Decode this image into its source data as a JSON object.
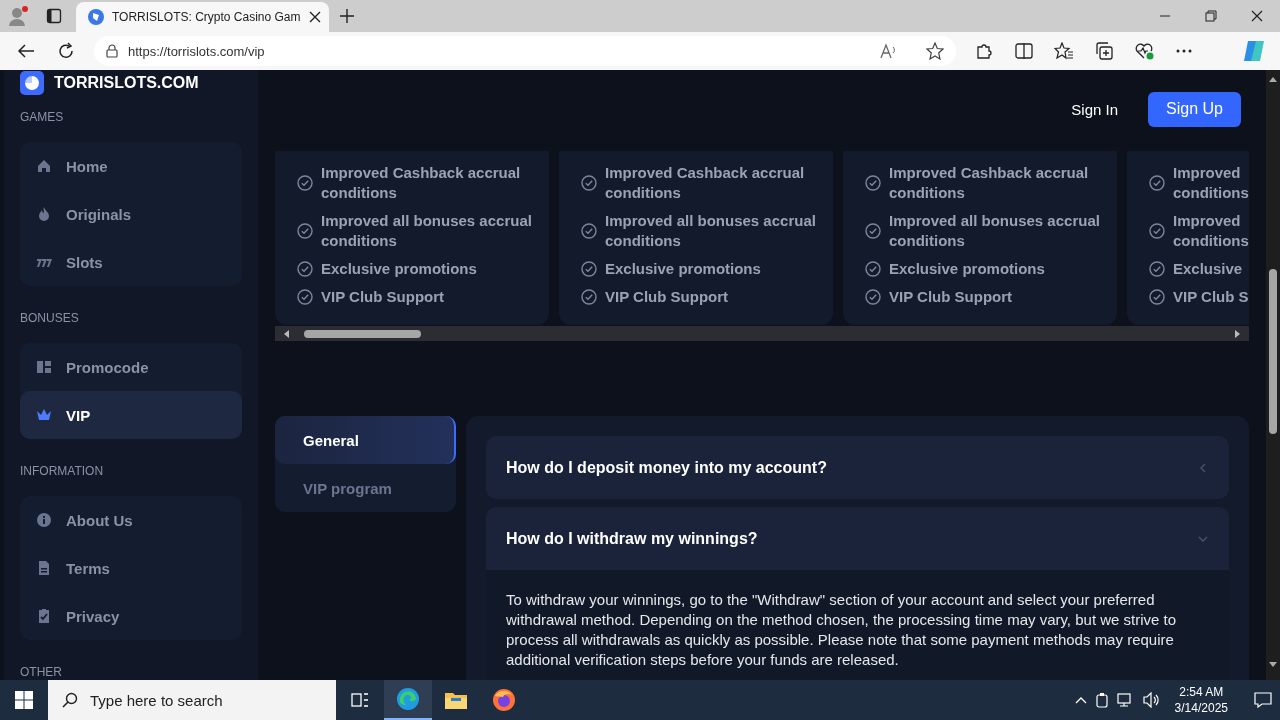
{
  "browser": {
    "tab_title": "TORRISLOTS: Crypto Casino Gam",
    "url": "https://torrislots.com/vip"
  },
  "sidebar": {
    "logo": "TORRISLOTS.COM",
    "sections": [
      {
        "label": "GAMES",
        "items": [
          {
            "label": "Home",
            "selected": false
          },
          {
            "label": "Originals",
            "selected": false
          },
          {
            "label": "Slots",
            "selected": false
          }
        ]
      },
      {
        "label": "BONUSES",
        "items": [
          {
            "label": "Promocode",
            "selected": false
          },
          {
            "label": "VIP",
            "selected": true
          }
        ]
      },
      {
        "label": "INFORMATION",
        "items": [
          {
            "label": "About Us",
            "selected": false
          },
          {
            "label": "Terms",
            "selected": false
          },
          {
            "label": "Privacy",
            "selected": false
          }
        ]
      },
      {
        "label": "OTHER"
      }
    ]
  },
  "header": {
    "sign_in": "Sign In",
    "sign_up": "Sign Up"
  },
  "vip_cards": [
    {
      "features": [
        {
          "lines": [
            "Improved Cashback accrual conditions"
          ]
        },
        {
          "lines": [
            "Improved all bonuses accrual conditions"
          ]
        },
        {
          "lines": [
            "Exclusive promotions"
          ]
        },
        {
          "lines": [
            "VIP Club Support"
          ]
        }
      ]
    },
    {
      "features": [
        {
          "lines": [
            "Improved Cashback accrual conditions"
          ]
        },
        {
          "lines": [
            "Improved all bonuses accrual conditions"
          ]
        },
        {
          "lines": [
            "Exclusive promotions"
          ]
        },
        {
          "lines": [
            "VIP Club Support"
          ]
        }
      ]
    },
    {
      "features": [
        {
          "lines": [
            "Improved Cashback accrual conditions"
          ]
        },
        {
          "lines": [
            "Improved all bonuses accrual conditions"
          ]
        },
        {
          "lines": [
            "Exclusive promotions"
          ]
        },
        {
          "lines": [
            "VIP Club Support"
          ]
        }
      ]
    },
    {
      "features": [
        {
          "lines": [
            "Improved",
            "conditions"
          ]
        },
        {
          "lines": [
            "Improved",
            "conditions"
          ]
        },
        {
          "lines": [
            "Exclusive"
          ]
        },
        {
          "lines": [
            "VIP Club S"
          ]
        }
      ]
    }
  ],
  "faq": {
    "tabs": [
      {
        "label": "General",
        "selected": true
      },
      {
        "label": "VIP program",
        "selected": false
      }
    ],
    "items": [
      {
        "question": "How do I deposit money into my account?",
        "expanded": false
      },
      {
        "question": "How do I withdraw my winnings?",
        "expanded": true,
        "answer": "To withdraw your winnings, go to the \"Withdraw\" section of your account and select your preferred withdrawal method. Depending on the method chosen, the processing time may vary, but we strive to process all withdrawals as quickly as possible. Please note that some payment methods may require additional verification steps before your funds are released."
      }
    ]
  },
  "taskbar": {
    "search_placeholder": "Type here to search",
    "time": "2:54 AM",
    "date": "3/14/2025"
  }
}
